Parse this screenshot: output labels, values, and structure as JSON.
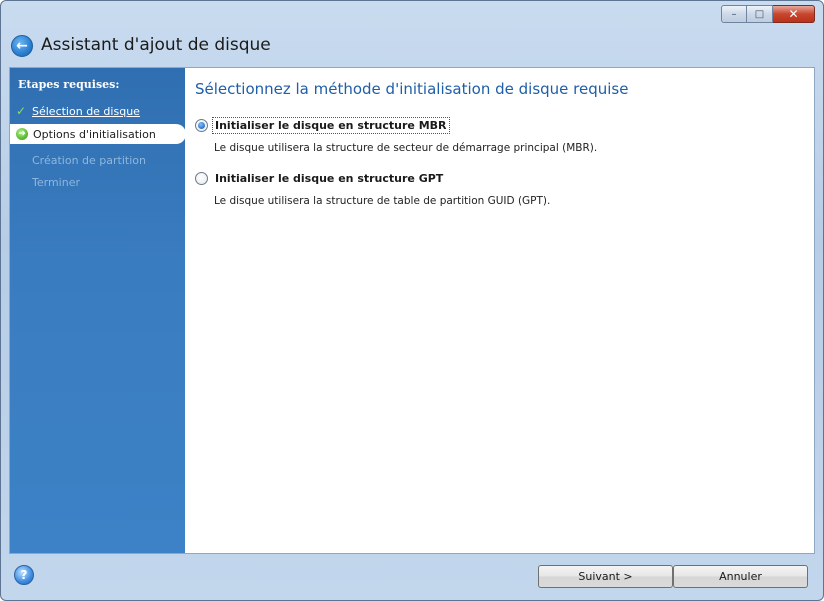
{
  "window": {
    "title": "Assistant d'ajout de disque",
    "controls": {
      "minimize": "–",
      "maximize": "□",
      "close": "✕"
    }
  },
  "sidebar": {
    "heading": "Etapes requises:",
    "steps": [
      {
        "label": "Sélection de disque",
        "state": "done",
        "icon": "check-icon"
      },
      {
        "label": "Options d'initialisation",
        "state": "current",
        "icon": "arrow-right-icon"
      },
      {
        "label": "Création de partition",
        "state": "future"
      },
      {
        "label": "Terminer",
        "state": "future"
      }
    ]
  },
  "main": {
    "heading": "Sélectionnez la méthode d'initialisation de disque requise",
    "options": [
      {
        "label": "Initialiser le disque en structure MBR",
        "description": "Le disque utilisera la structure de secteur de démarrage principal (MBR).",
        "checked": true
      },
      {
        "label": "Initialiser le disque en structure GPT",
        "description": "Le disque utilisera la structure de table de partition GUID (GPT).",
        "checked": false
      }
    ]
  },
  "footer": {
    "help_icon": "?",
    "next_label": "Suivant >",
    "cancel_label": "Annuler"
  },
  "colors": {
    "sidebar": "#3a7cc0",
    "heading": "#1f5ea8",
    "future_step": "#8eb7de"
  }
}
